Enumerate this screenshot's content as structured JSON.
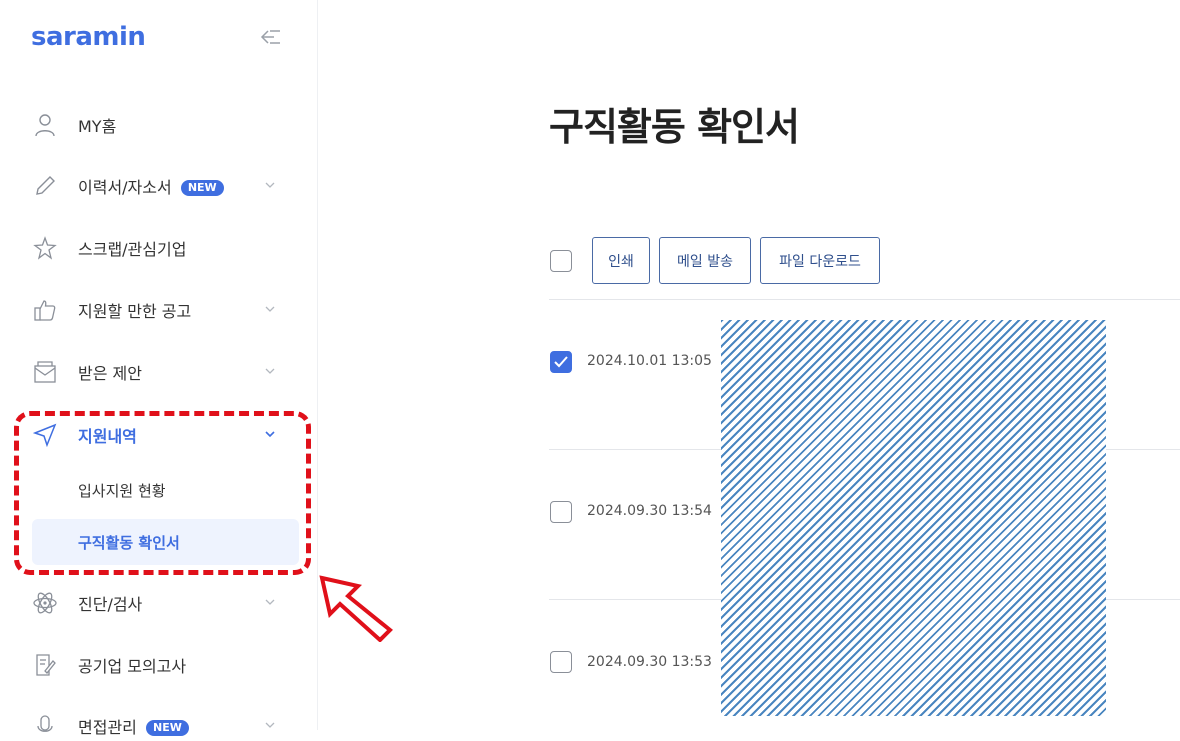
{
  "sidebar": {
    "logo": "saramin",
    "items": [
      {
        "label": "MY홈"
      },
      {
        "label": "이력서/자소서",
        "badge": "NEW"
      },
      {
        "label": "스크랩/관심기업"
      },
      {
        "label": "지원할 만한 공고"
      },
      {
        "label": "받은 제안"
      },
      {
        "label": "지원내역"
      },
      {
        "label": "진단/검사"
      },
      {
        "label": "공기업 모의고사"
      },
      {
        "label": "면접관리",
        "badge": "NEW"
      }
    ],
    "subitems": [
      {
        "label": "입사지원 현황"
      },
      {
        "label": "구직활동 확인서"
      }
    ]
  },
  "main": {
    "title": "구직활동 확인서",
    "toolbar": {
      "print": "인쇄",
      "mail": "메일 발송",
      "download": "파일 다운로드"
    },
    "rows": [
      {
        "date": "2024.10.01 13:05",
        "checked": true
      },
      {
        "date": "2024.09.30 13:54",
        "checked": false
      },
      {
        "date": "2024.09.30 13:53",
        "checked": false
      }
    ]
  },
  "colors": {
    "accent": "#3f6ee0",
    "highlight": "#e0101a",
    "selected_bg": "#eef3fe"
  }
}
